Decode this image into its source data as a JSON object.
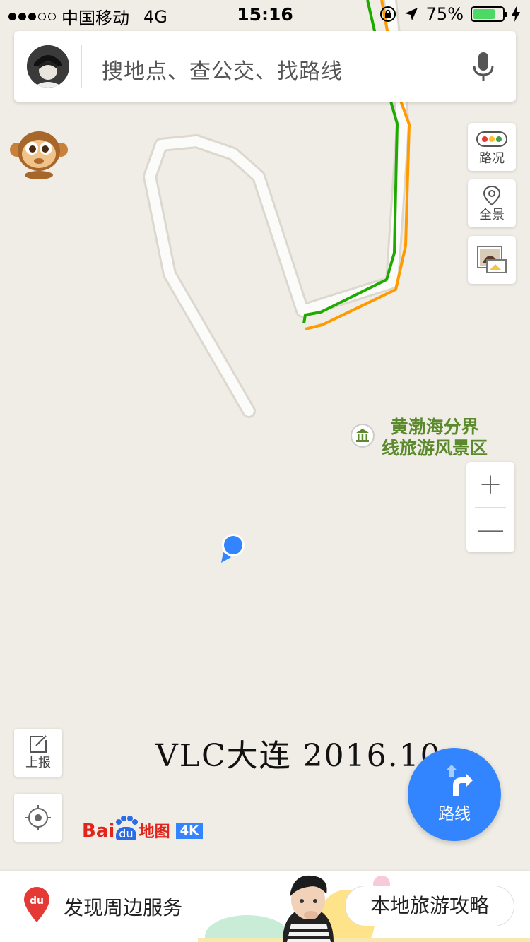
{
  "status_bar": {
    "carrier": "中国移动",
    "network": "4G",
    "time": "15:16",
    "battery_percent": "75%",
    "battery_level": 0.75,
    "signal_strength": 3
  },
  "search": {
    "placeholder": "搜地点、查公交、找路线"
  },
  "side_tools": {
    "traffic_label": "路况",
    "panorama_label": "全景"
  },
  "map": {
    "poi_name_line1": "黄渤海分界",
    "poi_name_line2": "线旅游风景区",
    "poi_color": "#5b8a2c",
    "route_colors": [
      "#1faa00",
      "#ff9a00"
    ],
    "watermark": "VLC大连 2016.10"
  },
  "zoom": {
    "in_label": "+",
    "out_label": "—"
  },
  "actions": {
    "report_label": "上报",
    "route_label": "路线"
  },
  "brand": {
    "bai": "Bai",
    "du": "du",
    "map": "地图",
    "badge": "4K"
  },
  "bottom_bar": {
    "discover_label": "发现周边服务",
    "guide_label": "本地旅游攻略"
  },
  "colors": {
    "accent": "#3385ff",
    "map_background": "#f0ede6"
  }
}
